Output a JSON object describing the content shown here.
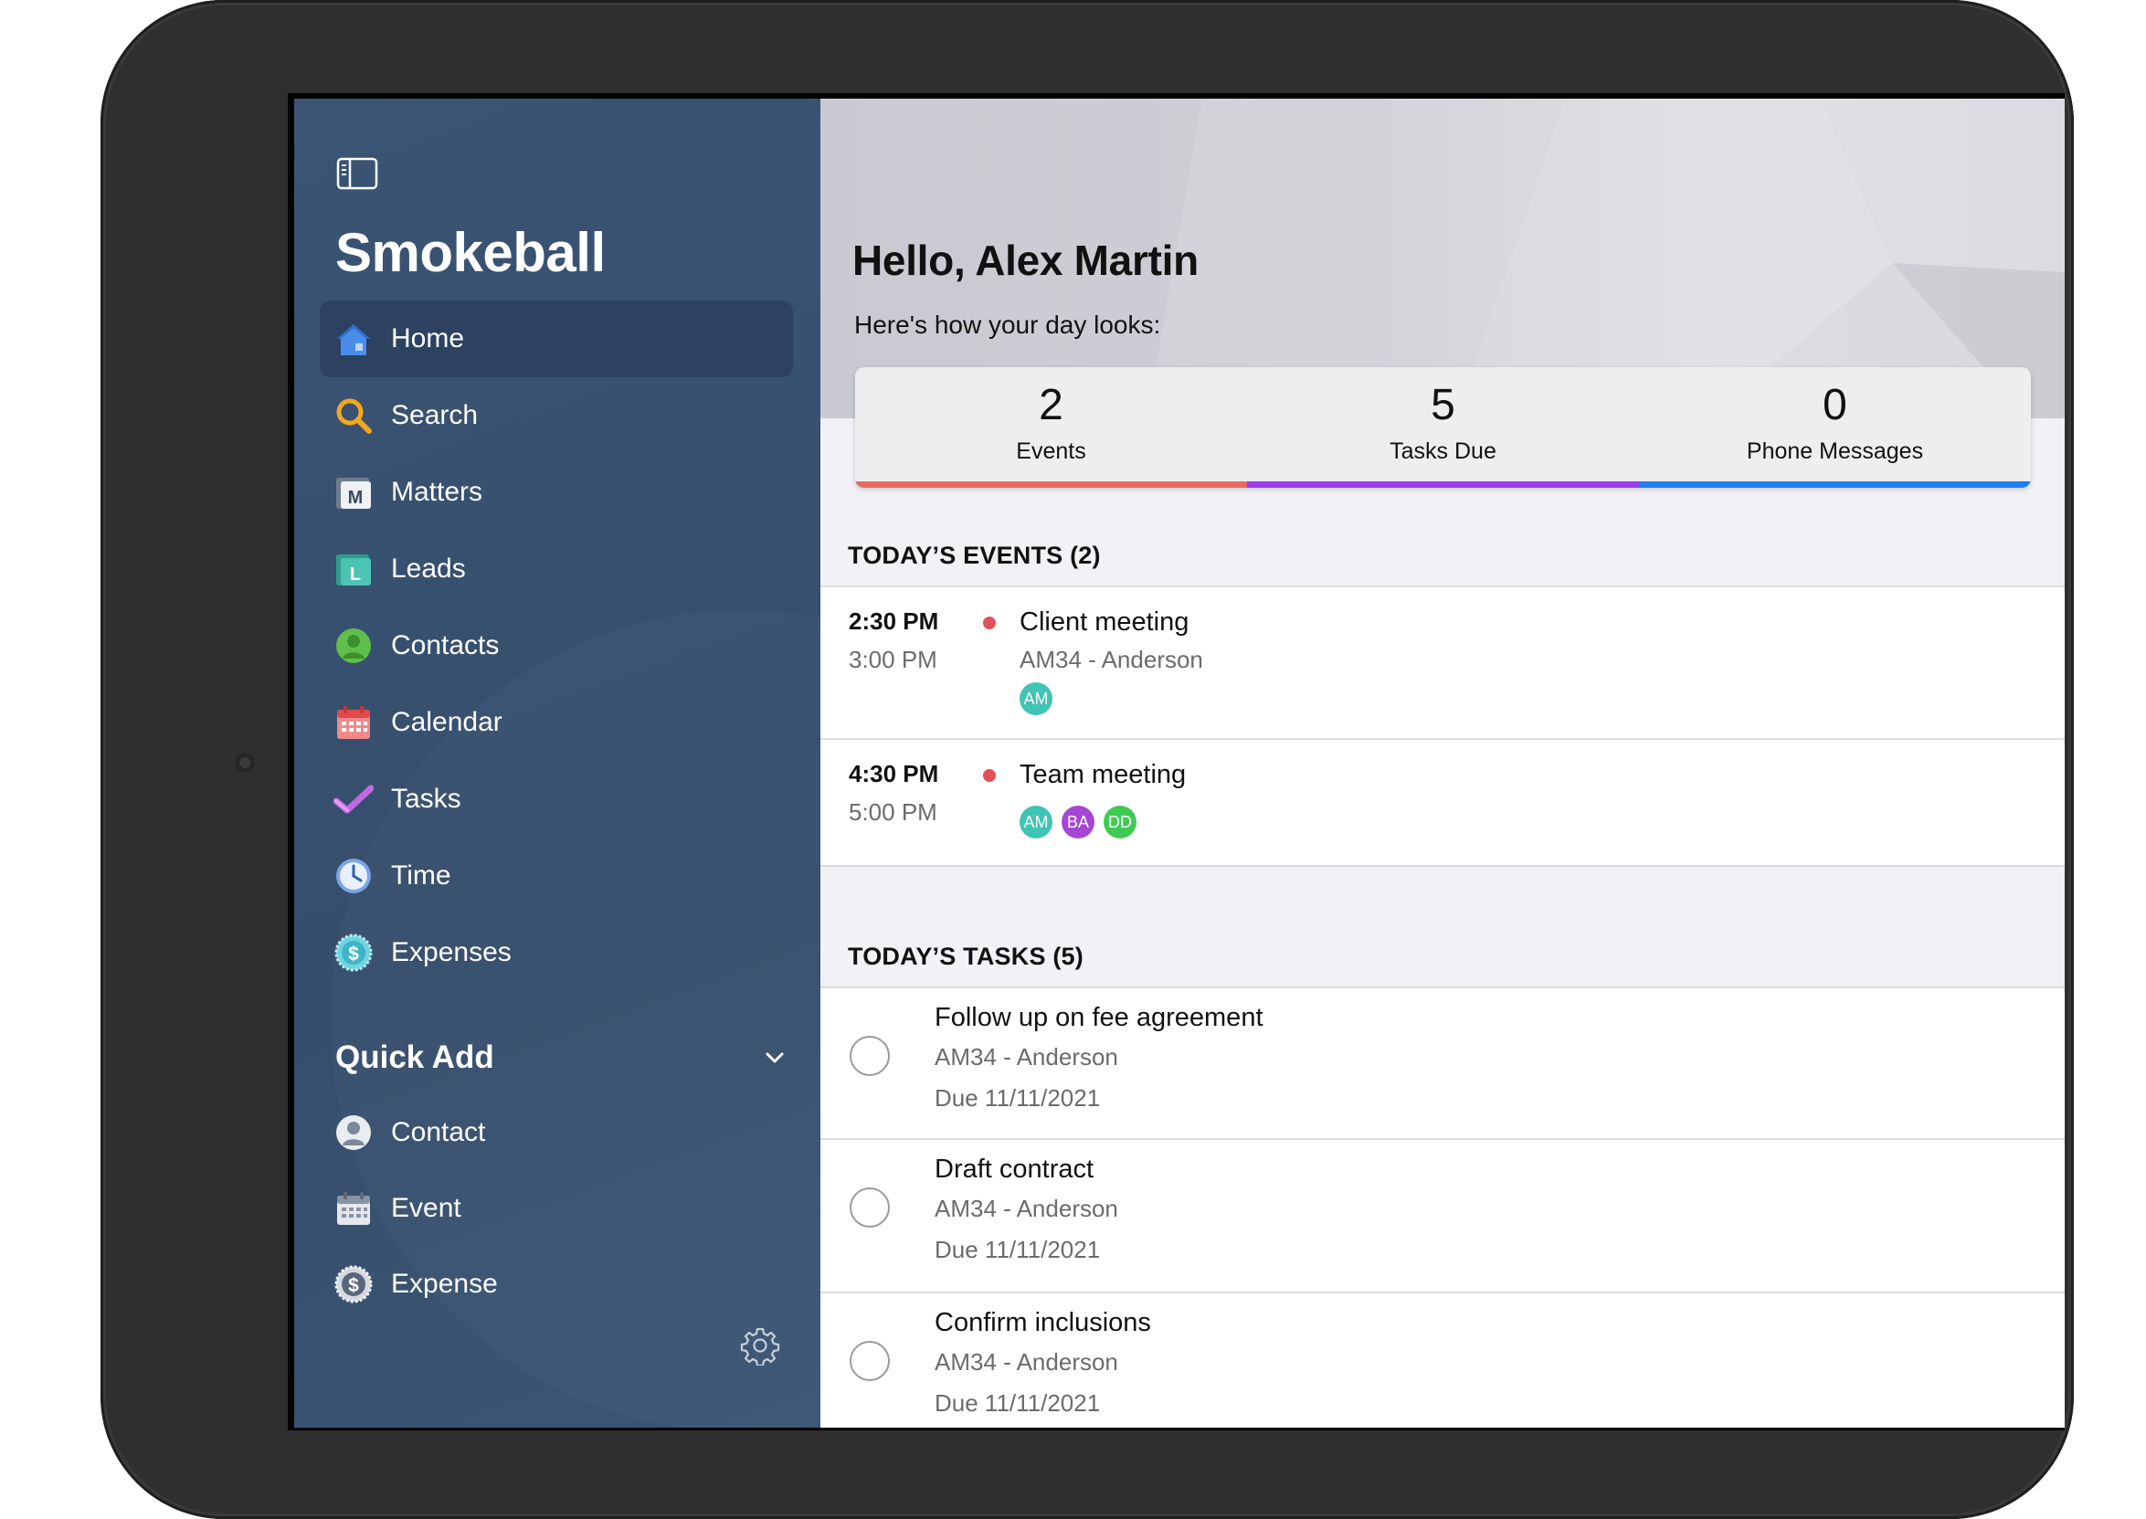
{
  "sidebar": {
    "brand": "Smokeball",
    "nav": [
      {
        "label": "Home",
        "icon": "home-icon",
        "active": true
      },
      {
        "label": "Search",
        "icon": "search-icon"
      },
      {
        "label": "Matters",
        "icon": "matters-icon"
      },
      {
        "label": "Leads",
        "icon": "leads-icon"
      },
      {
        "label": "Contacts",
        "icon": "contacts-icon"
      },
      {
        "label": "Calendar",
        "icon": "calendar-icon"
      },
      {
        "label": "Tasks",
        "icon": "tasks-icon"
      },
      {
        "label": "Time",
        "icon": "clock-icon"
      },
      {
        "label": "Expenses",
        "icon": "expenses-icon"
      }
    ],
    "quick_add": {
      "title": "Quick Add",
      "items": [
        {
          "label": "Contact",
          "icon": "contact-icon"
        },
        {
          "label": "Event",
          "icon": "event-icon"
        },
        {
          "label": "Expense",
          "icon": "expense-icon"
        }
      ]
    }
  },
  "main": {
    "greeting": "Hello, Alex Martin",
    "subtitle": "Here's how your day looks:",
    "summary": [
      {
        "value": "2",
        "label": "Events",
        "color": "#e56b5d"
      },
      {
        "value": "5",
        "label": "Tasks Due",
        "color": "#9b3ee8"
      },
      {
        "value": "0",
        "label": "Phone Messages",
        "color": "#1e7ff0"
      }
    ],
    "events_heading": "TODAY’S EVENTS (2)",
    "events": [
      {
        "start": "2:30 PM",
        "end": "3:00 PM",
        "title": "Client meeting",
        "matter": "AM34 - Anderson",
        "dot_color": "#e0525a",
        "attendees": [
          {
            "initials": "AM",
            "color": "#3fc4b5"
          }
        ]
      },
      {
        "start": "4:30 PM",
        "end": "5:00 PM",
        "title": "Team meeting",
        "matter": "",
        "dot_color": "#e0525a",
        "attendees": [
          {
            "initials": "AM",
            "color": "#3fc4b5"
          },
          {
            "initials": "BA",
            "color": "#a646d4"
          },
          {
            "initials": "DD",
            "color": "#3fcb53"
          }
        ]
      }
    ],
    "tasks_heading": "TODAY’S TASKS (5)",
    "tasks": [
      {
        "title": "Follow up on fee agreement",
        "matter": "AM34 - Anderson",
        "due": "Due 11/11/2021"
      },
      {
        "title": "Draft contract",
        "matter": "AM34 - Anderson",
        "due": "Due 11/11/2021"
      },
      {
        "title": "Confirm inclusions",
        "matter": "AM34 - Anderson",
        "due": "Due 11/11/2021"
      }
    ]
  }
}
